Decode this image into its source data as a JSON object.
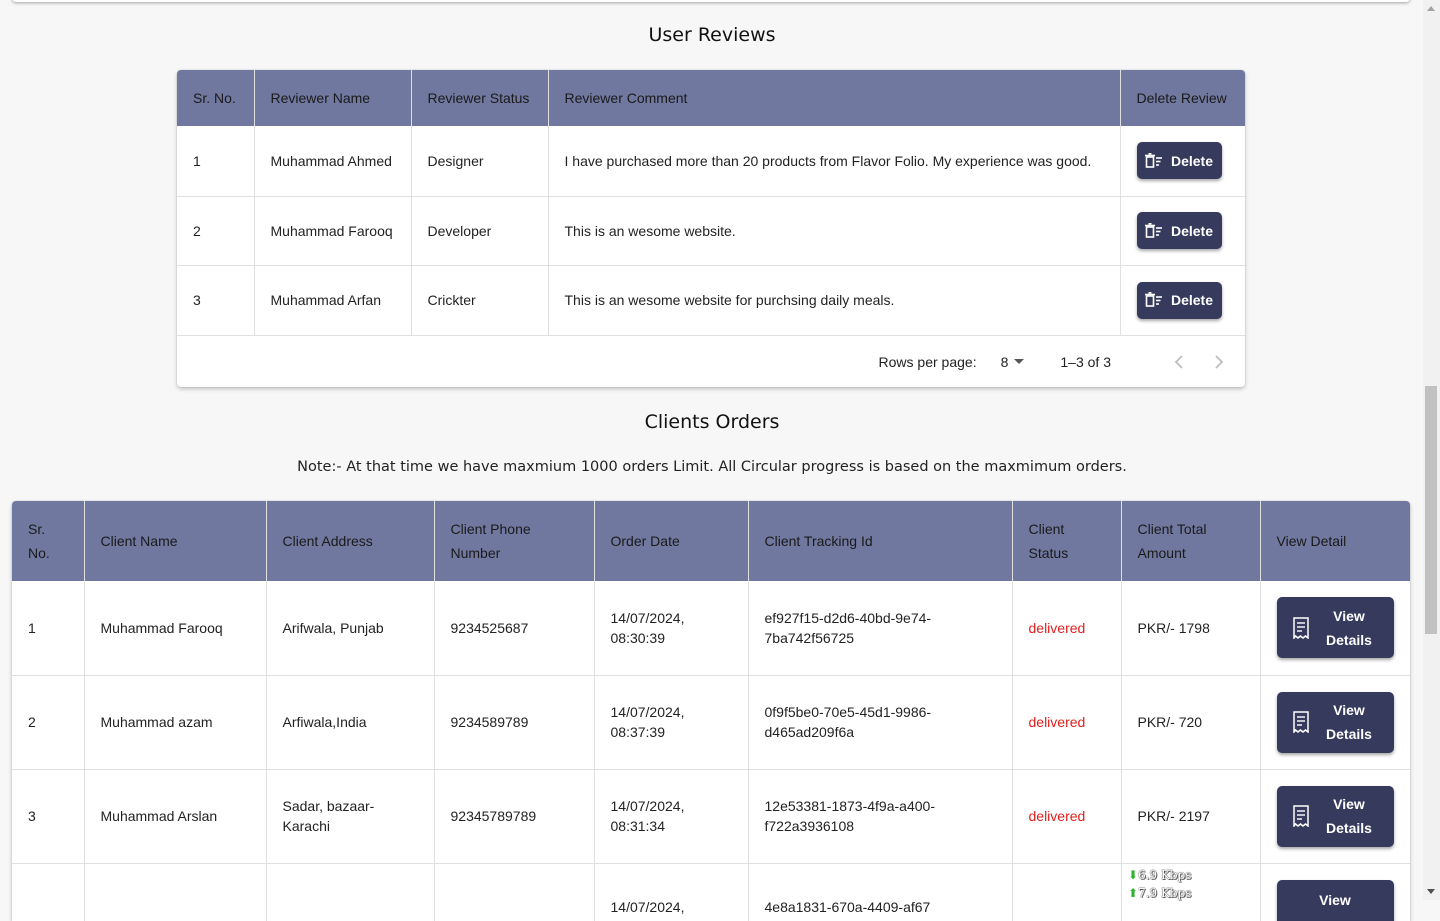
{
  "reviews": {
    "title": "User Reviews",
    "headers": [
      "Sr. No.",
      "Reviewer Name",
      "Reviewer Status",
      "Reviewer Comment",
      "Delete Review"
    ],
    "rows": [
      {
        "sr": "1",
        "name": "Muhammad Ahmed",
        "status": "Designer",
        "comment": "I have purchased more than 20 products from Flavor Folio. My experience was good.",
        "action": "Delete"
      },
      {
        "sr": "2",
        "name": "Muhammad Farooq",
        "status": "Developer",
        "comment": "This is an wesome website.",
        "action": "Delete"
      },
      {
        "sr": "3",
        "name": "Muhammad Arfan",
        "status": "Crickter",
        "comment": "This is an wesome website for purchsing daily meals.",
        "action": "Delete"
      }
    ],
    "pagination": {
      "rows_per_page_label": "Rows per page:",
      "rows_per_page_value": "8",
      "range": "1–3 of 3"
    }
  },
  "orders": {
    "title": "Clients Orders",
    "note": "Note:- At that time we have maxmium 1000 orders  Limit. All Circular progress is based on the maxmimum orders.",
    "headers": [
      "Sr. No.",
      "Client Name",
      "Client Address",
      "Client Phone Number",
      "Order Date",
      "Client Tracking Id",
      "Client Status",
      "Client Total Amount",
      "View Detail"
    ],
    "rows": [
      {
        "sr": "1",
        "name": "Muhammad Farooq",
        "address": "Arifwala, Punjab",
        "phone": "9234525687",
        "date": "14/07/2024, 08:30:39",
        "tracking": "ef927f15-d2d6-40bd-9e74-7ba742f56725",
        "status": "delivered",
        "amount": "PKR/- 1798",
        "action": "View Details"
      },
      {
        "sr": "2",
        "name": "Muhammad azam",
        "address": "Arfiwala,India",
        "phone": "9234589789",
        "date": "14/07/2024, 08:37:39",
        "tracking": "0f9f5be0-70e5-45d1-9986-d465ad209f6a",
        "status": "delivered",
        "amount": "PKR/- 720",
        "action": "View Details"
      },
      {
        "sr": "3",
        "name": "Muhammad Arslan",
        "address": "Sadar, bazaar-Karachi",
        "phone": "92345789789",
        "date": "14/07/2024, 08:31:34",
        "tracking": "12e53381-1873-4f9a-a400-f722a3936108",
        "status": "delivered",
        "amount": "PKR/- 2197",
        "action": "View Details"
      },
      {
        "sr": "",
        "name": "",
        "address": "",
        "phone": "",
        "date": "14/07/2024,",
        "tracking": "4e8a1831-670a-4409-af67",
        "status": "",
        "amount": "",
        "action": "View"
      }
    ]
  },
  "netspeed": {
    "down": "6.9 Kbps",
    "up": "7.9 Kbps"
  },
  "colors": {
    "header_bg": "#7078a0",
    "button_bg": "#363a5c",
    "delivered": "#e0201e"
  }
}
